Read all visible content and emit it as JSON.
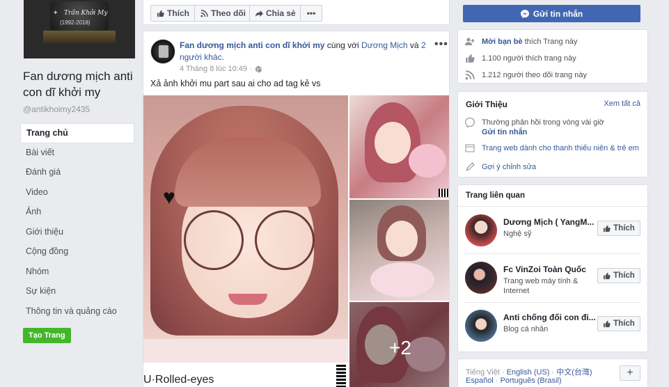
{
  "cover": {
    "caption": "Trần Khởi My",
    "dates": "(1992-2018)"
  },
  "page": {
    "name": "Fan dương mịch anti con dĩ khởi my",
    "handle": "@antikhoimy2435"
  },
  "nav": [
    {
      "label": "Trang chủ",
      "active": true
    },
    {
      "label": "Bài viết"
    },
    {
      "label": "Đánh giá"
    },
    {
      "label": "Video"
    },
    {
      "label": "Ảnh"
    },
    {
      "label": "Giới thiệu"
    },
    {
      "label": "Cộng đồng"
    },
    {
      "label": "Nhóm"
    },
    {
      "label": "Sự kiện"
    },
    {
      "label": "Thông tin và quảng cáo"
    }
  ],
  "create_page": "Tạo Trang",
  "actions": {
    "like": "Thích",
    "follow": "Theo dõi",
    "share": "Chia sẻ"
  },
  "post": {
    "author": "Fan dương mịch anti con dĩ khởi my",
    "with_text": " cùng với ",
    "tagged": "Dương Mịch",
    "and_text": " và ",
    "others": "2 người khác.",
    "timestamp": "4 Tháng 8 lúc 10:49 · ",
    "text": "Xả ảnh khởi mu part sau ai cho ad tag kẻ vs",
    "photo_caption": "U·Rolled-eyes",
    "more_count": "+2"
  },
  "send_message": "Gửi tin nhắn",
  "stats": {
    "invite_bold": "Mời bạn bè",
    "invite_rest": " thích Trang này",
    "likes": "1.100 người thích trang này",
    "follows": "1.212 người theo dõi trang này"
  },
  "about": {
    "title": "Giới Thiệu",
    "see_all": "Xem tất cả",
    "response": "Thường phản hồi trong vòng vài giờ",
    "send_message": "Gửi tin nhắn",
    "category": "Trang web dành cho thanh thiếu niên & trẻ em",
    "suggest": "Gợi ý chỉnh sửa"
  },
  "related": {
    "title": "Trang liên quan",
    "items": [
      {
        "name": "Dương Mịch ( YangM...",
        "sub": "Nghệ sỹ",
        "like": "Thích"
      },
      {
        "name": "Fc VinZoi Toàn Quốc",
        "sub": "Trang web máy tính & Internet",
        "like": "Thích"
      },
      {
        "name": "Anti chống đối con đi...",
        "sub": "Blog cá nhân",
        "like": "Thích"
      }
    ]
  },
  "languages": {
    "line1": [
      "Tiếng Việt",
      "English (US)",
      "中文(台灣)"
    ],
    "line2": [
      "Español",
      "Português (Brasil)"
    ]
  },
  "colors": {
    "fb_blue": "#4267b2",
    "link": "#365899",
    "green": "#42b72a"
  }
}
